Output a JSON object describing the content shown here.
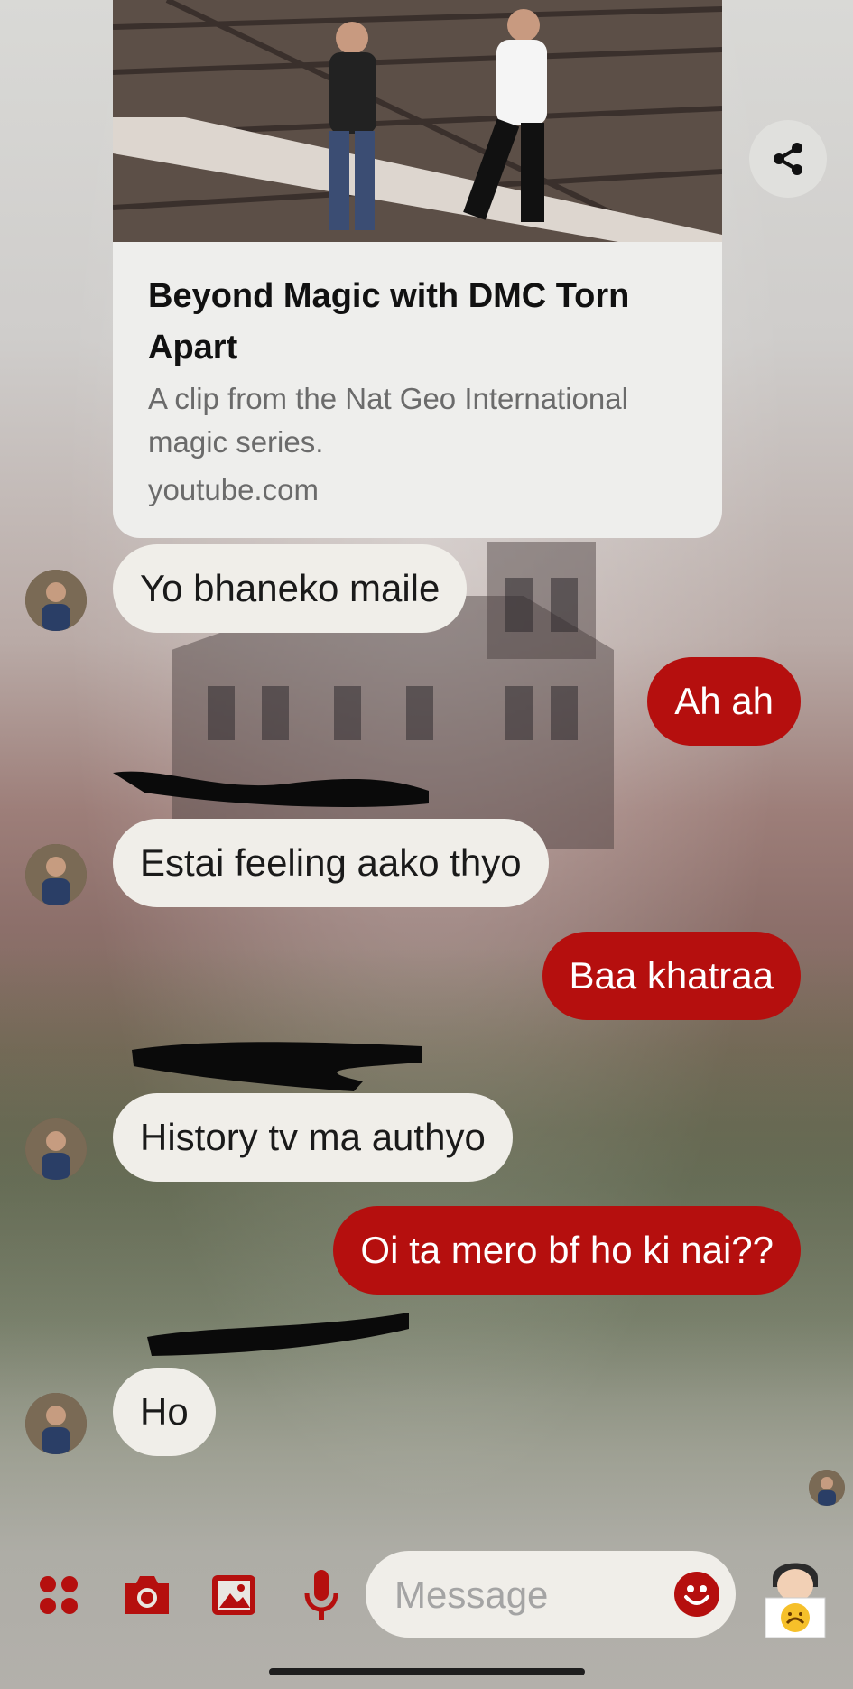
{
  "link_card": {
    "title": "Beyond Magic with DMC Torn Apart",
    "description": "A clip from the Nat Geo International magic series.",
    "domain": "youtube.com"
  },
  "messages": [
    {
      "side": "in",
      "text": "Yo bhaneko maile"
    },
    {
      "side": "out",
      "text": "Ah ah"
    },
    {
      "side": "in",
      "text": "Estai feeling aako thyo"
    },
    {
      "side": "out",
      "text": "Baa khatraa"
    },
    {
      "side": "in",
      "text": "History tv ma authyo"
    },
    {
      "side": "out",
      "text": "Oi ta mero bf ho ki nai??"
    },
    {
      "side": "in",
      "text": "Ho"
    }
  ],
  "composer": {
    "placeholder": "Message"
  },
  "icons": {
    "apps": "apps-grid-icon",
    "camera": "camera-icon",
    "gallery": "image-icon",
    "mic": "microphone-icon",
    "emoji": "emoji-icon",
    "share": "share-icon",
    "sticker": "bitmoji-sticker-icon"
  },
  "colors": {
    "accent": "#b50f0e",
    "incoming_bubble": "#f0eee9",
    "outgoing_text": "#ffffff"
  }
}
